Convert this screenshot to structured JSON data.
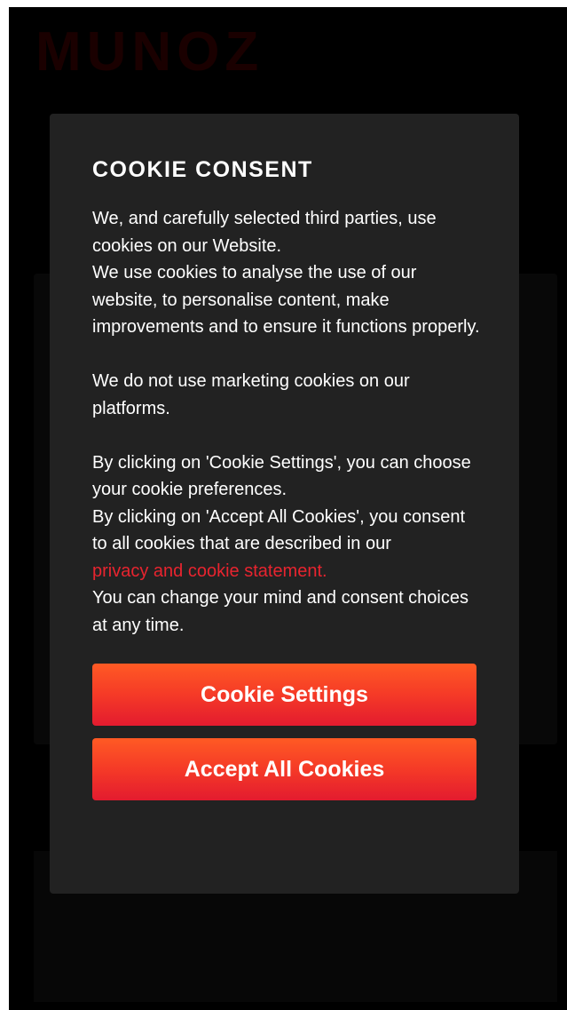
{
  "brand": {
    "logo_text": "MUNOZ"
  },
  "colors": {
    "overlay": "#000000",
    "modal_background": "#222222",
    "link": "#e8242f",
    "button_gradient_top": "#ff5a24",
    "button_gradient_bottom": "#e31b2f"
  },
  "modal": {
    "title": "COOKIE CONSENT",
    "paragraph_1_line_1": "We, and carefully selected third parties, use cookies on our Website.",
    "paragraph_1_line_2": "We use cookies to analyse the use of our website, to personalise content, make improvements and to ensure it functions properly.",
    "paragraph_2": "We do not use marketing cookies on our platforms.",
    "paragraph_3_line_1": "By clicking on 'Cookie Settings', you can choose your cookie preferences.",
    "paragraph_3_line_2": "By clicking on 'Accept All Cookies', you consent to all cookies that are described in our",
    "privacy_link": "privacy and cookie statement.",
    "paragraph_3_line_3": "You can change your mind and consent choices at any time.",
    "cookie_settings_button": "Cookie Settings",
    "accept_all_button": "Accept All Cookies"
  }
}
